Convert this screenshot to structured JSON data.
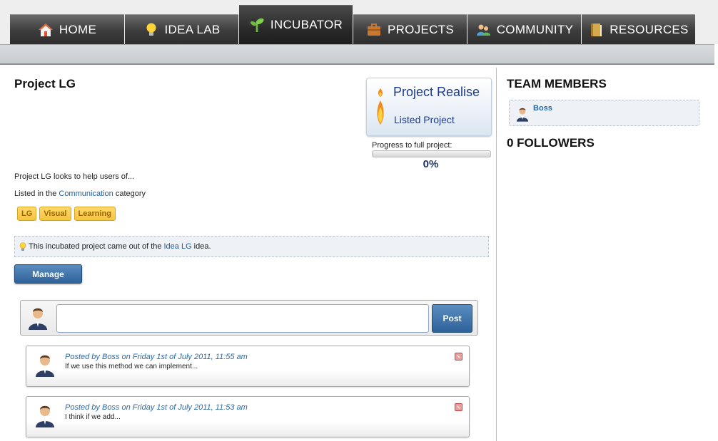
{
  "nav": {
    "tabs": [
      {
        "label": "HOME",
        "icon": "home-icon",
        "active": false
      },
      {
        "label": "IDEA LAB",
        "icon": "lightbulb-icon",
        "active": false
      },
      {
        "label": "INCUBATOR",
        "icon": "sprout-icon",
        "active": true
      },
      {
        "label": "PROJECTS",
        "icon": "briefcase-icon",
        "active": false
      },
      {
        "label": "COMMUNITY",
        "icon": "people-icon",
        "active": false
      },
      {
        "label": "RESOURCES",
        "icon": "book-icon",
        "active": false
      }
    ]
  },
  "project": {
    "title": "Project LG",
    "description": "Project LG looks to help users of...",
    "category_prefix": "Listed in the ",
    "category": "Communication",
    "category_suffix": " category",
    "tags": [
      "LG",
      "Visual",
      "Learning"
    ],
    "notice_prefix": "This incubated project came out of the ",
    "notice_link": "Idea LG",
    "notice_suffix": " idea.",
    "manage_label": "Manage"
  },
  "badge": {
    "line1": "Project Realise",
    "line2": "Listed Project"
  },
  "progress": {
    "label": "Progress to full project:",
    "value_text": "0%",
    "fraction": 0
  },
  "composer": {
    "post_label": "Post",
    "input_value": ""
  },
  "comments": [
    {
      "meta": "Posted by Boss on Friday 1st of July 2011, 11:55 am",
      "text": "If we use this method we can implement..."
    },
    {
      "meta": "Posted by Boss on Friday 1st of July 2011, 11:53 am",
      "text": "I think if we add..."
    }
  ],
  "sidebar": {
    "team_heading": "TEAM MEMBERS",
    "members": [
      "Boss"
    ],
    "followers_heading": "0 FOLLOWERS"
  },
  "colors": {
    "accent_blue": "#2e6299",
    "link": "#1b5ea4",
    "tag_bg": "#f6c33f"
  }
}
